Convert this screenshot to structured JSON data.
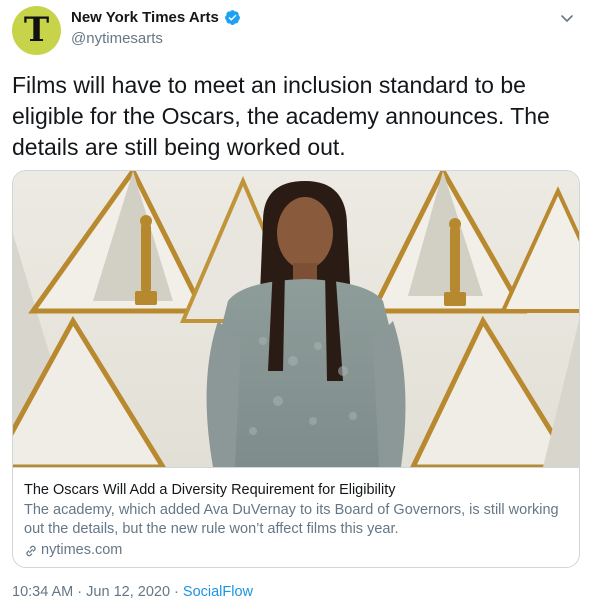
{
  "author": {
    "name": "New York Times Arts",
    "handle": "@nytimesarts",
    "avatar_glyph": "T",
    "avatar_color": "#c7d44a",
    "verified": true,
    "verified_icon": "verified-badge-icon"
  },
  "menu_icon": "chevron-down-icon",
  "tweet": {
    "text": "Films will have to meet an inclusion standard to be eligible for the Oscars, the academy announces. The details are still being worked out."
  },
  "card": {
    "title": "The Oscars Will Add a Diversity Requirement for Eligibility",
    "description": "The academy, which added Ava DuVernay to its Board of Governors, is still working out the details, but the new rule won’t affect films this year.",
    "domain": "nytimes.com",
    "domain_icon": "link-icon",
    "image": "woman-in-lace-gown-photo"
  },
  "footer": {
    "time": "10:34 AM",
    "separator1": " · ",
    "date": "Jun 12, 2020",
    "separator2": " · ",
    "source": "SocialFlow"
  },
  "colors": {
    "text": "#14171a",
    "secondary": "#657786",
    "link": "#1b95e0",
    "border": "#ccd6dd",
    "verified": "#1da1f2"
  }
}
